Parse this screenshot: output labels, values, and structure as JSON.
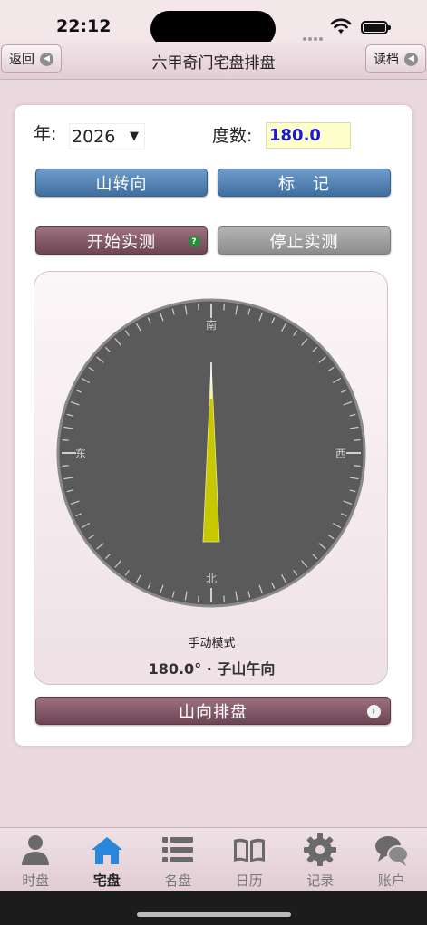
{
  "status": {
    "time": "22:12"
  },
  "nav": {
    "title": "六甲奇门宅盘排盘",
    "back_label": "返回",
    "read_label": "读档"
  },
  "form": {
    "year_label": "年:",
    "year_value": "2026",
    "degree_label": "度数:",
    "degree_value": "180.0"
  },
  "buttons": {
    "turn_mountain": "山转向",
    "mark": "标　记",
    "start_measure": "开始实测",
    "stop_measure": "停止实测",
    "arrange": "山向排盘"
  },
  "compass": {
    "heading_degrees": 180.0,
    "dir_top": "南",
    "dir_bottom": "北",
    "dir_left": "东",
    "dir_right": "西",
    "mode_text": "手动模式",
    "reading_text": "180.0° · 子山午向",
    "needle_color": "#c8c800",
    "face_color": "#5a5a5a"
  },
  "tabs": [
    {
      "label": "时盘",
      "icon": "person-icon"
    },
    {
      "label": "宅盘",
      "icon": "house-icon"
    },
    {
      "label": "名盘",
      "icon": "list-icon"
    },
    {
      "label": "日历",
      "icon": "book-icon"
    },
    {
      "label": "记录",
      "icon": "gear-icon"
    },
    {
      "label": "账户",
      "icon": "chat-icon"
    }
  ],
  "active_tab": "宅盘"
}
